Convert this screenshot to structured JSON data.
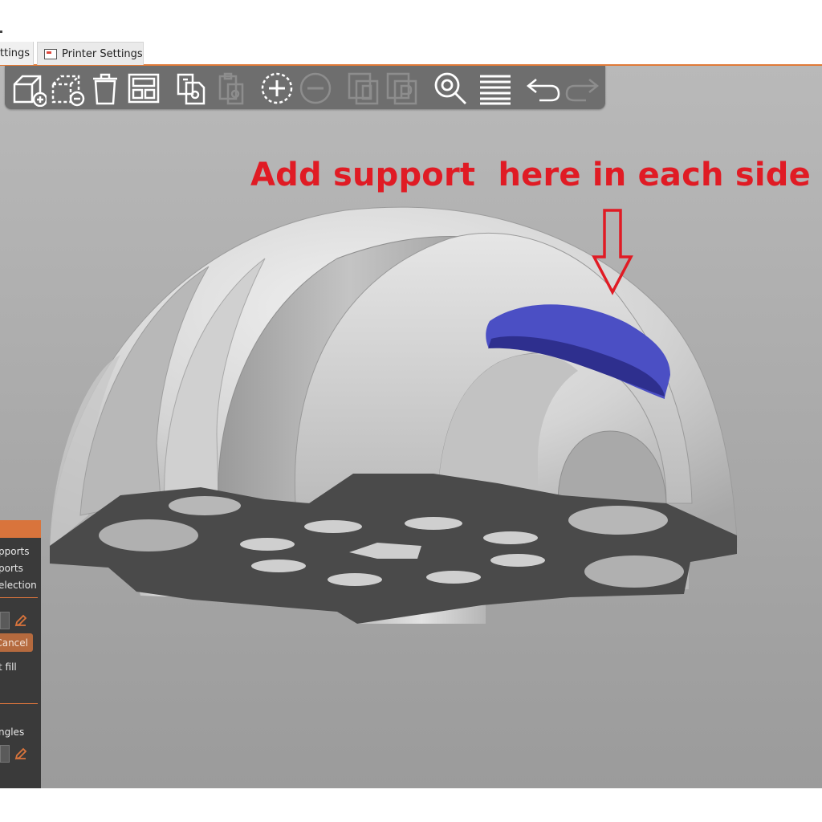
{
  "tabs": {
    "prev_tab_label": "ttings",
    "printer_tab_label": "Printer Settings"
  },
  "toolbar": {
    "buttons": [
      {
        "icon": "add-icon",
        "enabled": true
      },
      {
        "icon": "delete-icon",
        "enabled": true
      },
      {
        "icon": "delete-all-icon",
        "enabled": true
      },
      {
        "icon": "arrange-icon",
        "enabled": true
      },
      {
        "icon": "copy-icon",
        "enabled": true
      },
      {
        "icon": "paste-icon",
        "enabled": false
      },
      {
        "icon": "add-instance-icon",
        "enabled": true
      },
      {
        "icon": "remove-instance-icon",
        "enabled": false
      },
      {
        "icon": "split-objects-icon",
        "enabled": false
      },
      {
        "icon": "split-parts-icon",
        "enabled": false
      },
      {
        "icon": "search-icon",
        "enabled": true
      },
      {
        "icon": "layers-icon",
        "enabled": true
      },
      {
        "icon": "undo-icon",
        "enabled": true
      },
      {
        "icon": "redo-icon",
        "enabled": false
      }
    ]
  },
  "annotation": {
    "text": "Add support  here in each side",
    "color": "#e01b24"
  },
  "colors": {
    "accent": "#d9743c",
    "painted_support": "#4b4fc4",
    "model": "#d6d6d6",
    "bed_plate": "#4a4a4a"
  },
  "left_panel": {
    "line1": "pports",
    "line2": "ports",
    "line3": "election",
    "cancel_label": "Cancel",
    "fill_label": "t fill",
    "angles_label": "ngles"
  }
}
